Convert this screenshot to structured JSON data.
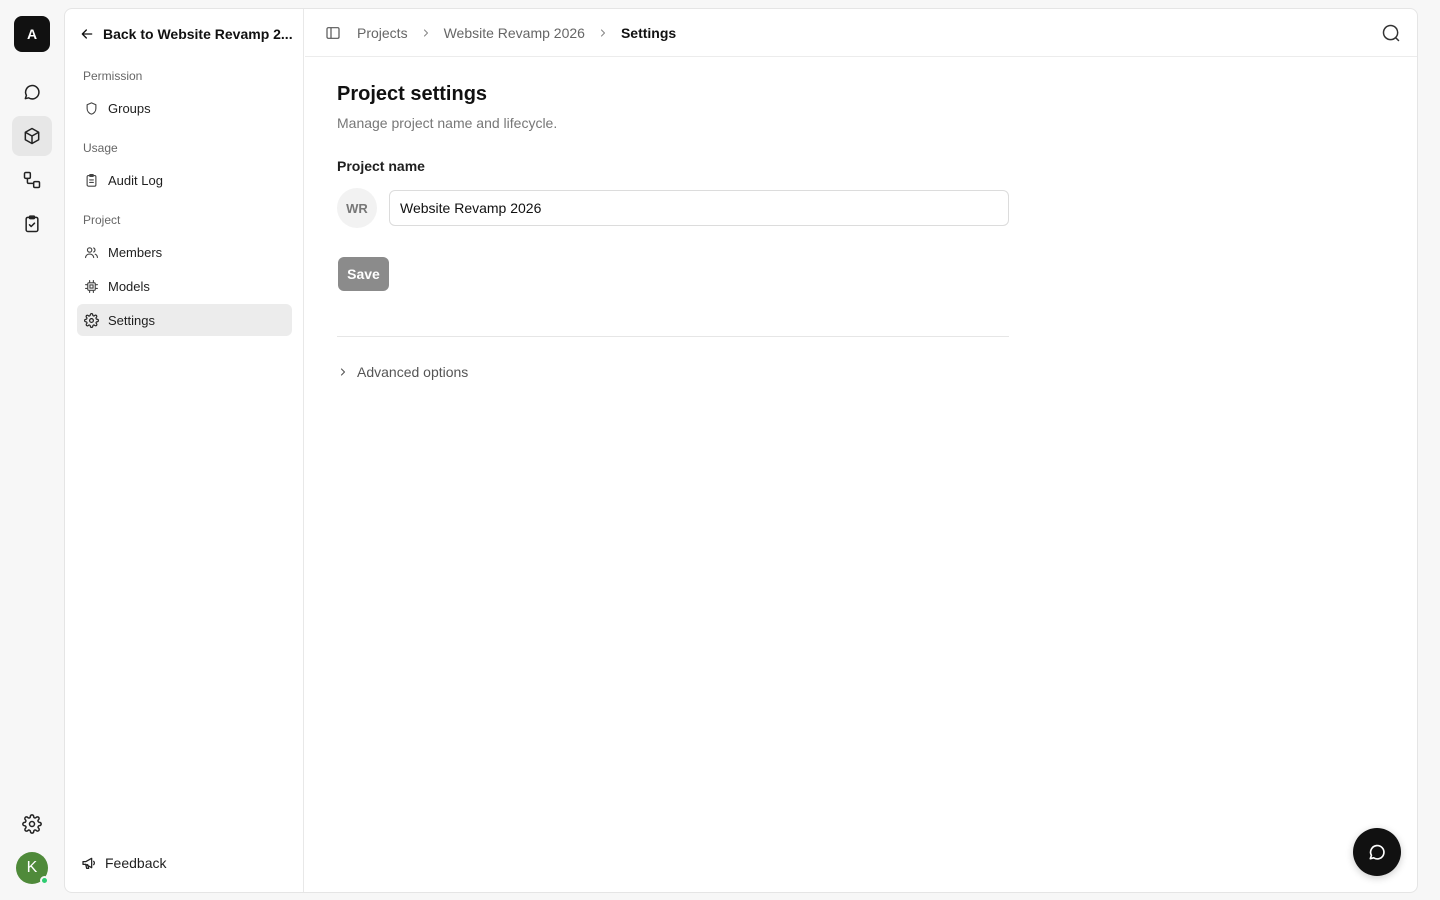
{
  "rail": {
    "logo": "A",
    "items": [
      {
        "icon": "chat-icon"
      },
      {
        "icon": "cube-icon",
        "active": true
      },
      {
        "icon": "workflow-icon"
      },
      {
        "icon": "clipboard-check-icon"
      }
    ],
    "settings_icon": "gear-icon",
    "user_initial": "K"
  },
  "sidebar": {
    "back_label": "Back to Website Revamp 2...",
    "sections": [
      {
        "label": "Permission",
        "items": [
          {
            "label": "Groups",
            "icon": "shield-icon"
          }
        ]
      },
      {
        "label": "Usage",
        "items": [
          {
            "label": "Audit Log",
            "icon": "clipboard-icon"
          }
        ]
      },
      {
        "label": "Project",
        "items": [
          {
            "label": "Members",
            "icon": "users-icon"
          },
          {
            "label": "Models",
            "icon": "chip-icon"
          },
          {
            "label": "Settings",
            "icon": "gear-icon",
            "active": true
          }
        ]
      }
    ],
    "feedback_label": "Feedback"
  },
  "header": {
    "breadcrumbs": [
      "Projects",
      "Website Revamp 2026",
      "Settings"
    ]
  },
  "main": {
    "title": "Project settings",
    "subtitle": "Manage project name and lifecycle.",
    "project_name_label": "Project name",
    "initials": "WR",
    "project_name_value": "Website Revamp 2026",
    "save_label": "Save",
    "advanced_label": "Advanced options"
  },
  "colors": {
    "accent_dark": "#111111",
    "active_bg": "#ececec",
    "save_disabled": "#8b8b8b",
    "avatar_green": "#4f8a3a",
    "online": "#2ecc71"
  }
}
